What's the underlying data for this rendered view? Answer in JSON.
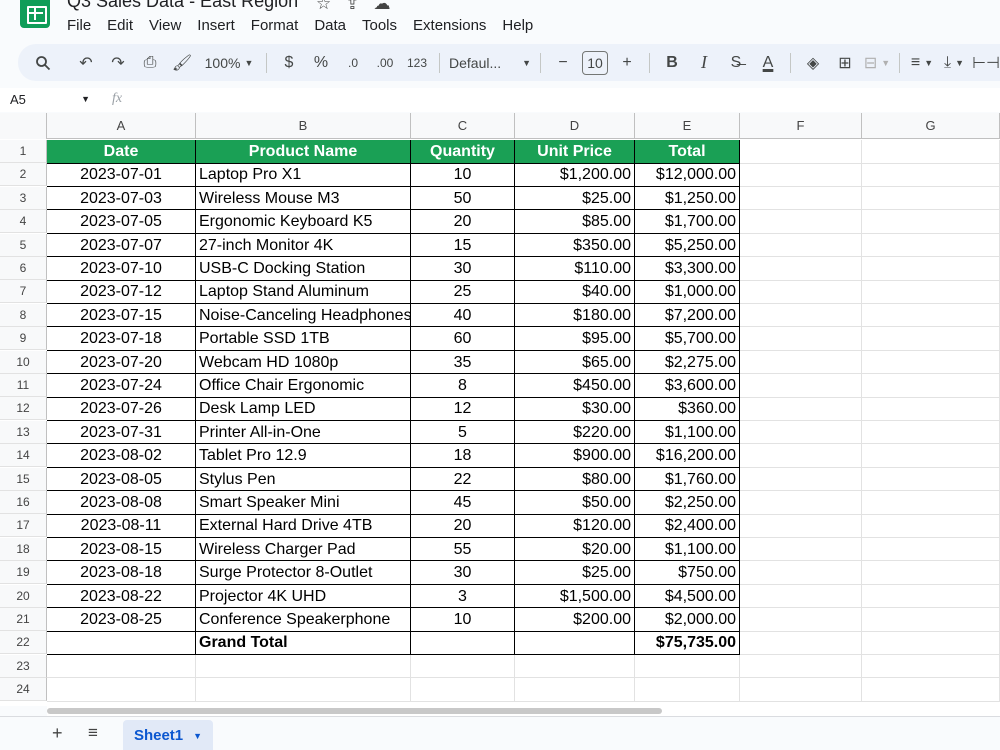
{
  "app": {
    "doc_title": "Q3 Sales Data - East Region"
  },
  "menu": [
    "File",
    "Edit",
    "View",
    "Insert",
    "Format",
    "Data",
    "Tools",
    "Extensions",
    "Help"
  ],
  "toolbar": {
    "zoom": "100%",
    "currency": "$",
    "percent": "%",
    "dec_decrease": ".0",
    "dec_increase": ".00",
    "number_format": "123",
    "font": "Defaul...",
    "font_size": "10",
    "bold": "B",
    "italic": "I"
  },
  "formula_bar": {
    "cell_ref": "A5",
    "fx_symbol": "fx"
  },
  "columns": [
    "A",
    "B",
    "C",
    "D",
    "E",
    "F",
    "G"
  ],
  "rows": [
    "1",
    "2",
    "3",
    "4",
    "5",
    "6",
    "7",
    "8",
    "9",
    "10",
    "11",
    "12",
    "13",
    "14",
    "15",
    "16",
    "17",
    "18",
    "19",
    "20",
    "21",
    "22",
    "23",
    "24"
  ],
  "table": {
    "headers": [
      "Date",
      "Product Name",
      "Quantity",
      "Unit Price",
      "Total"
    ],
    "rows": [
      [
        "2023-07-01",
        "Laptop Pro X1",
        "10",
        "$1,200.00",
        "$12,000.00"
      ],
      [
        "2023-07-03",
        "Wireless Mouse M3",
        "50",
        "$25.00",
        "$1,250.00"
      ],
      [
        "2023-07-05",
        "Ergonomic Keyboard K5",
        "20",
        "$85.00",
        "$1,700.00"
      ],
      [
        "2023-07-07",
        "27-inch Monitor 4K",
        "15",
        "$350.00",
        "$5,250.00"
      ],
      [
        "2023-07-10",
        "USB-C Docking Station",
        "30",
        "$110.00",
        "$3,300.00"
      ],
      [
        "2023-07-12",
        "Laptop Stand Aluminum",
        "25",
        "$40.00",
        "$1,000.00"
      ],
      [
        "2023-07-15",
        "Noise-Canceling Headphones",
        "40",
        "$180.00",
        "$7,200.00"
      ],
      [
        "2023-07-18",
        "Portable SSD 1TB",
        "60",
        "$95.00",
        "$5,700.00"
      ],
      [
        "2023-07-20",
        "Webcam HD 1080p",
        "35",
        "$65.00",
        "$2,275.00"
      ],
      [
        "2023-07-24",
        "Office Chair Ergonomic",
        "8",
        "$450.00",
        "$3,600.00"
      ],
      [
        "2023-07-26",
        "Desk Lamp LED",
        "12",
        "$30.00",
        "$360.00"
      ],
      [
        "2023-07-31",
        "Printer All-in-One",
        "5",
        "$220.00",
        "$1,100.00"
      ],
      [
        "2023-08-02",
        "Tablet Pro 12.9",
        "18",
        "$900.00",
        "$16,200.00"
      ],
      [
        "2023-08-05",
        "Stylus Pen",
        "22",
        "$80.00",
        "$1,760.00"
      ],
      [
        "2023-08-08",
        "Smart Speaker Mini",
        "45",
        "$50.00",
        "$2,250.00"
      ],
      [
        "2023-08-11",
        "External Hard Drive 4TB",
        "20",
        "$120.00",
        "$2,400.00"
      ],
      [
        "2023-08-15",
        "Wireless Charger Pad",
        "55",
        "$20.00",
        "$1,100.00"
      ],
      [
        "2023-08-18",
        "Surge Protector 8-Outlet",
        "30",
        "$25.00",
        "$750.00"
      ],
      [
        "2023-08-22",
        "Projector 4K UHD",
        "3",
        "$1,500.00",
        "$4,500.00"
      ],
      [
        "2023-08-25",
        "Conference Speakerphone",
        "10",
        "$200.00",
        "$2,000.00"
      ]
    ],
    "total_row": [
      "",
      "Grand Total",
      "",
      "",
      "$75,735.00"
    ]
  },
  "sheets": {
    "active": "Sheet1"
  },
  "colors": {
    "header_green": "#1aa055",
    "tab_blue": "#0b57d0"
  }
}
